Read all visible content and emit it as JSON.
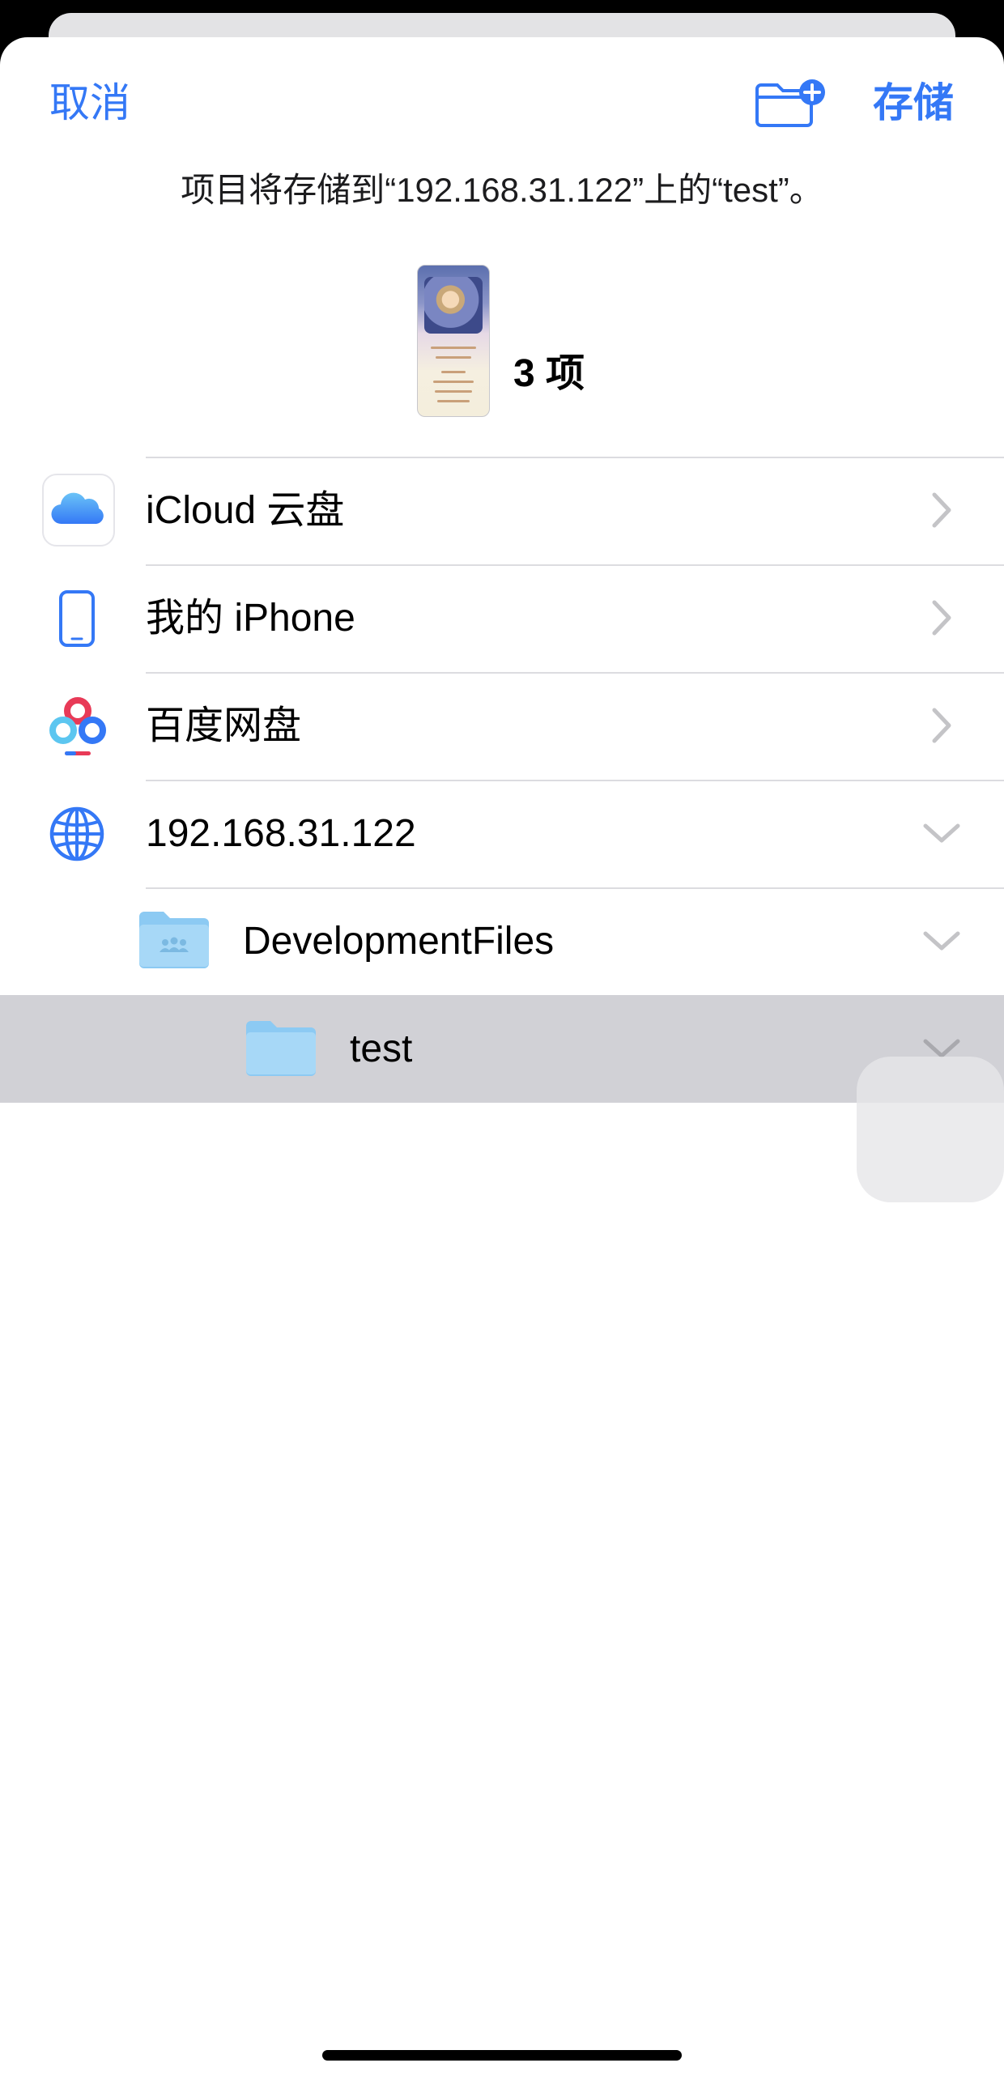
{
  "nav": {
    "cancel_label": "取消",
    "save_label": "存储",
    "new_folder_icon": "folder-badge-plus-icon"
  },
  "destination_text": "项目将存储到“192.168.31.122”上的“test”。",
  "preview": {
    "count_label": "3 项"
  },
  "locations": [
    {
      "label": "iCloud 云盘",
      "icon": "icloud-icon",
      "chevron": "chevron-right"
    },
    {
      "label": "我的 iPhone",
      "icon": "iphone-icon",
      "chevron": "chevron-right"
    },
    {
      "label": "百度网盘",
      "icon": "baidu-netdisk-icon",
      "chevron": "chevron-right"
    },
    {
      "label": "192.168.31.122",
      "icon": "globe-icon",
      "chevron": "chevron-down"
    },
    {
      "label": "DevelopmentFiles",
      "icon": "shared-folder-icon",
      "chevron": "chevron-down"
    },
    {
      "label": "test",
      "icon": "folder-icon",
      "chevron": "chevron-down",
      "selected": true
    }
  ],
  "colors": {
    "accent": "#3478f6",
    "selected_row": "#d1d1d6",
    "folder": "#9fd3f6"
  }
}
